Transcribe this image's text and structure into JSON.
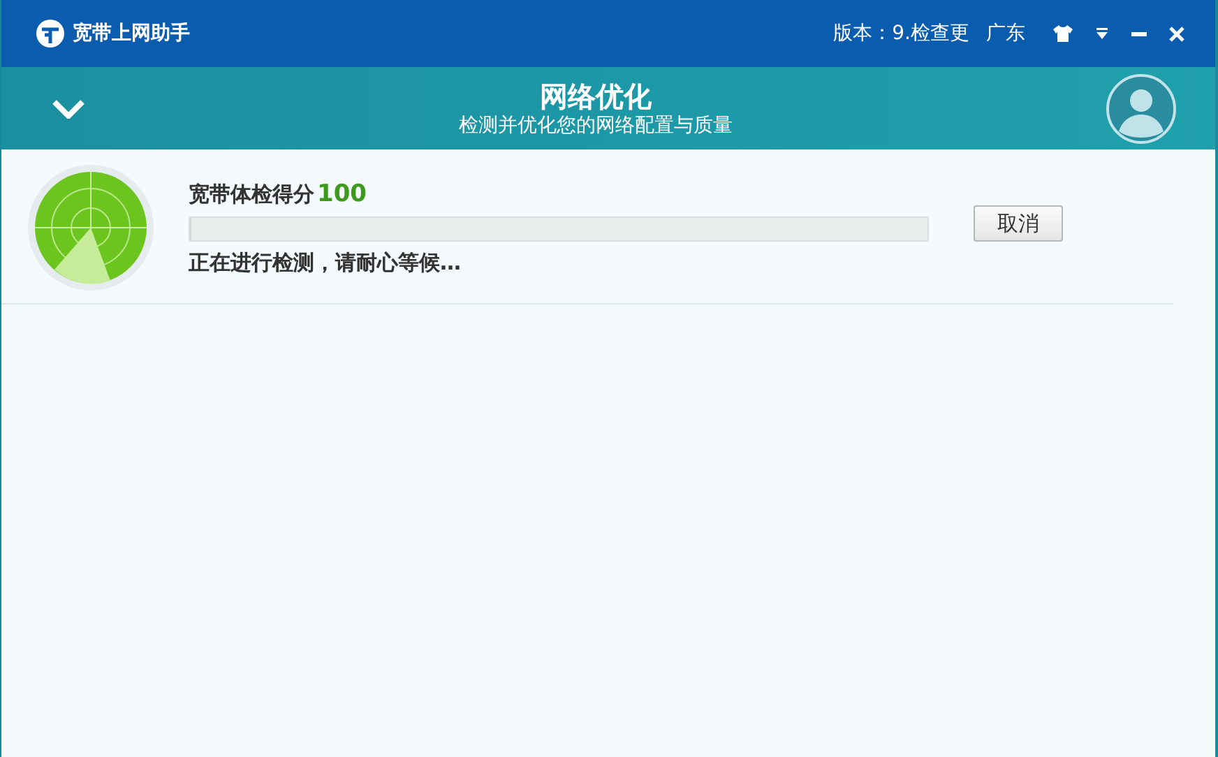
{
  "window": {
    "title": "宽带上网助手",
    "version": "版本：9.检查更",
    "region": "广东"
  },
  "header": {
    "title": "网络优化",
    "subtitle": "检测并优化您的网络配置与质量"
  },
  "check": {
    "label": "宽带体检得分",
    "score": "100",
    "level": 0,
    "status": "正在进行检测，请耐心等候…",
    "cancel": "取消"
  }
}
